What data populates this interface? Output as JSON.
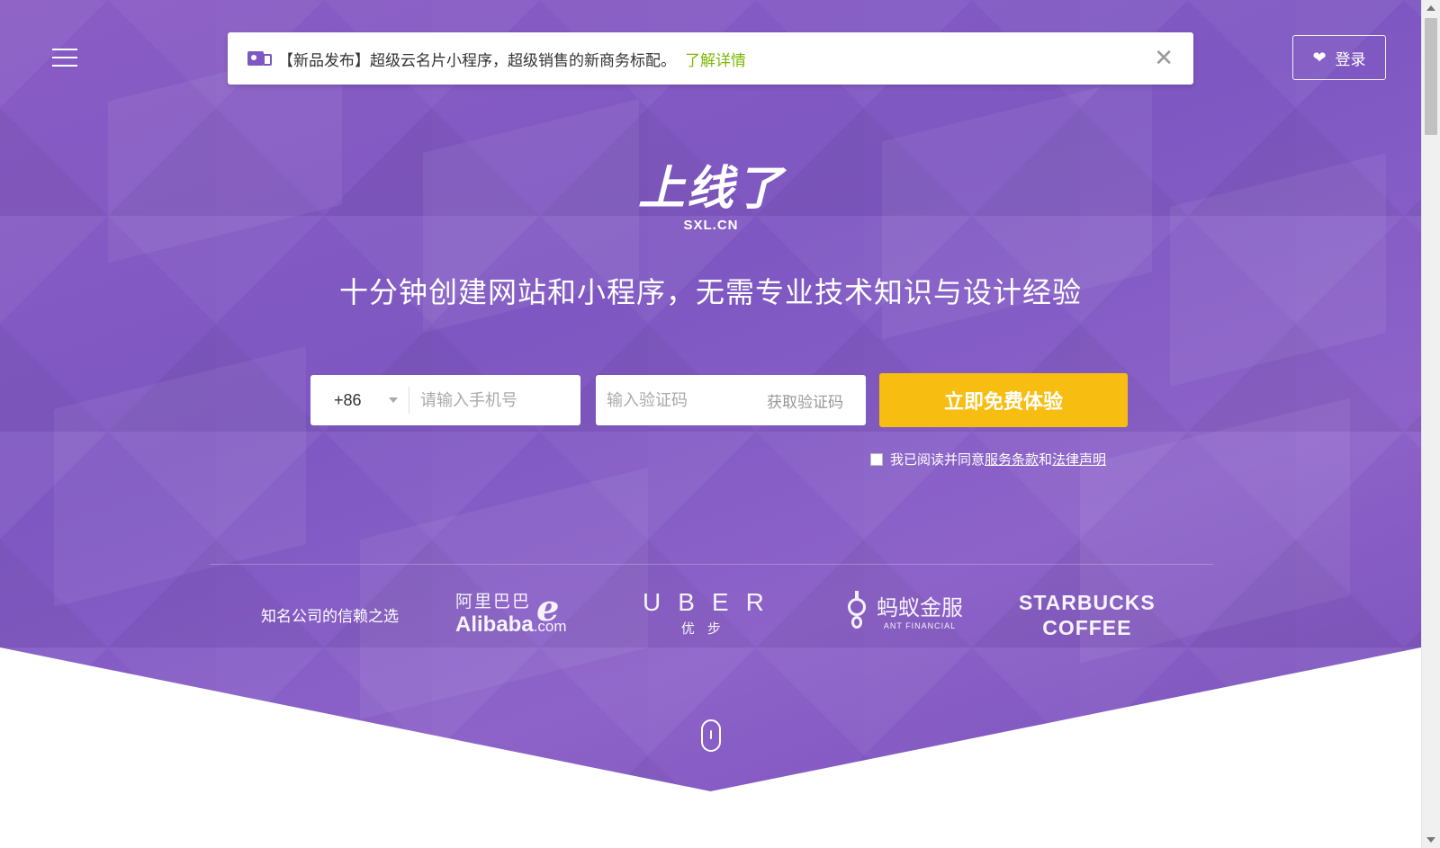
{
  "header": {
    "menu_icon": "hamburger-icon",
    "login_label": "登录",
    "login_icon": "heart-icon"
  },
  "notice": {
    "icon": "business-card-icon",
    "text": "【新品发布】超级云名片小程序，超级销售的新商务标配。",
    "link_label": "了解详情",
    "close_glyph": "✕"
  },
  "logo": {
    "cn": "上线了",
    "en": "SXL.CN"
  },
  "slogan": "十分钟创建网站和小程序，无需专业技术知识与设计经验",
  "form": {
    "country_code": "+86",
    "phone_placeholder": "请输入手机号",
    "code_placeholder": "输入验证码",
    "get_code_label": "获取验证码",
    "submit_label": "立即免费体验",
    "agree_prefix": "我已阅读并同意",
    "terms_label": "服务条款",
    "and": "和",
    "legal_label": "法律声明"
  },
  "trusted": {
    "label": "知名公司的信赖之选",
    "brands": {
      "alibaba_cn": "阿里巴巴",
      "alibaba_en": "Alibaba",
      "alibaba_suffix": ".com",
      "uber_en": "UBER",
      "uber_cn": "优步",
      "ant_cn": "蚂蚁金服",
      "ant_en": "ANT FINANCIAL",
      "starbucks_l1": "STARBUCKS",
      "starbucks_l2": "COFFEE"
    }
  },
  "colors": {
    "hero_purple": "#7e57c2",
    "accent_yellow": "#f7bd10",
    "link_green": "#7cb805"
  }
}
